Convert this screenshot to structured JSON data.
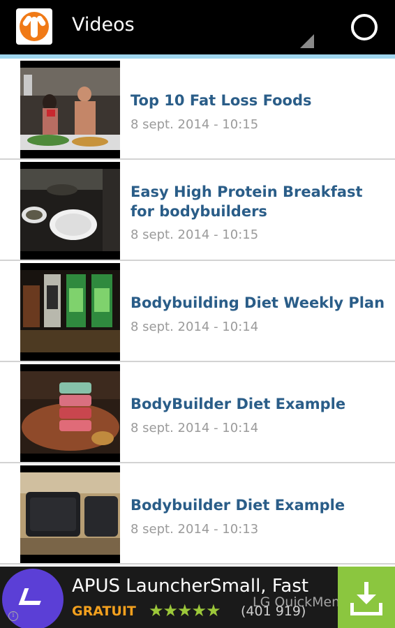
{
  "actionbar": {
    "title": "Videos",
    "icons": [
      "app-logo-icon",
      "spinner-dropdown-icon",
      "refresh-icon"
    ],
    "accent_color": "#9fd6ef"
  },
  "videos": [
    {
      "title": "Top 10 Fat Loss Foods",
      "date": "8 sept. 2014 - 10:15"
    },
    {
      "title": "Easy High Protein Breakfast for bodybuilders",
      "date": "8 sept. 2014 - 10:15"
    },
    {
      "title": "Bodybuilding Diet Weekly Plan",
      "date": "8 sept. 2014 - 10:14"
    },
    {
      "title": "BodyBuilder Diet Example",
      "date": "8 sept. 2014 - 10:14"
    },
    {
      "title": "Bodybuilder Diet Example",
      "date": "8 sept. 2014 - 10:13"
    }
  ],
  "ad": {
    "title": "APUS LauncherSmall, Fast",
    "price": "GRATUIT",
    "rating_stars": "★★★★★",
    "rating_count": "(401 919)",
    "watermark": "LG QuickMemo",
    "info_glyph": "i",
    "price_color": "#f2a01e",
    "download_color": "#8bc63f"
  },
  "colors": {
    "title_blue": "#2a5d88",
    "date_gray": "#9a9a9a"
  }
}
